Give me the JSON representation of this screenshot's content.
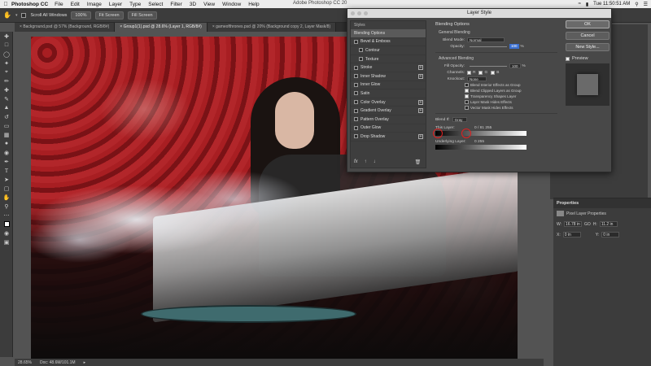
{
  "menubar": {
    "app": "Photoshop CC",
    "items": [
      "File",
      "Edit",
      "Image",
      "Layer",
      "Type",
      "Select",
      "Filter",
      "3D",
      "View",
      "Window",
      "Help"
    ],
    "center_title": "Adobe Photoshop CC 20",
    "clock": "Tue 11:50:51 AM"
  },
  "optbar": {
    "scroll_all": "Scroll All Windows",
    "zoom": "100%",
    "fit": "Fit Screen",
    "fill": "Fill Screen"
  },
  "tabs": [
    {
      "label": "Background.psd @ 57% (Background, RGB/8#)",
      "active": false
    },
    {
      "label": "Group1(1).psd @ 28.6% (Layer 1, RGB/8#)",
      "active": true
    },
    {
      "label": "gameofthrones.psd @ 20% (Background copy 2, Layer Mask/8)",
      "active": false
    }
  ],
  "status": {
    "zoom": "28.65%",
    "doc": "Doc: 48.6M/101.1M"
  },
  "dialog": {
    "title": "Layer Style",
    "styles_header": "Styles",
    "styles": [
      {
        "label": "Blending Options",
        "active": true,
        "checkbox": false,
        "plus": false
      },
      {
        "label": "Bevel & Emboss",
        "active": false,
        "checkbox": true,
        "plus": false
      },
      {
        "label": "Contour",
        "active": false,
        "checkbox": true,
        "plus": false,
        "indent": true
      },
      {
        "label": "Texture",
        "active": false,
        "checkbox": true,
        "plus": false,
        "indent": true
      },
      {
        "label": "Stroke",
        "active": false,
        "checkbox": true,
        "plus": true
      },
      {
        "label": "Inner Shadow",
        "active": false,
        "checkbox": true,
        "plus": true
      },
      {
        "label": "Inner Glow",
        "active": false,
        "checkbox": true,
        "plus": false
      },
      {
        "label": "Satin",
        "active": false,
        "checkbox": true,
        "plus": false
      },
      {
        "label": "Color Overlay",
        "active": false,
        "checkbox": true,
        "plus": true
      },
      {
        "label": "Gradient Overlay",
        "active": false,
        "checkbox": true,
        "plus": true
      },
      {
        "label": "Pattern Overlay",
        "active": false,
        "checkbox": true,
        "plus": false
      },
      {
        "label": "Outer Glow",
        "active": false,
        "checkbox": true,
        "plus": false
      },
      {
        "label": "Drop Shadow",
        "active": false,
        "checkbox": true,
        "plus": true
      }
    ],
    "blending": {
      "title": "Blending Options",
      "general": "General Blending",
      "blend_mode_label": "Blend Mode:",
      "blend_mode": "Normal",
      "opacity_label": "Opacity:",
      "opacity": "100",
      "percent": "%",
      "advanced": "Advanced Blending",
      "fill_opacity_label": "Fill Opacity:",
      "fill_opacity": "100",
      "channels_label": "Channels:",
      "channels": [
        "R",
        "G",
        "B"
      ],
      "knockout_label": "Knockout:",
      "knockout": "None",
      "options": [
        {
          "label": "Blend Interior Effects as Group",
          "checked": false
        },
        {
          "label": "Blend Clipped Layers as Group",
          "checked": true
        },
        {
          "label": "Transparency Shapes Layer",
          "checked": true
        },
        {
          "label": "Layer Mask Hides Effects",
          "checked": false
        },
        {
          "label": "Vector Mask Hides Effects",
          "checked": false
        }
      ],
      "blend_if_label": "Blend If:",
      "blend_if": "Gray",
      "this_layer_label": "This Layer:",
      "this_layer_values": "0 / 81    255",
      "underlying_label": "Underlying Layer:",
      "underlying_values": "0         255"
    },
    "buttons": {
      "ok": "OK",
      "cancel": "Cancel",
      "new_style": "New Style...",
      "preview": "Preview"
    },
    "footer": "fx"
  },
  "properties": {
    "title": "Properties",
    "subtitle": "Pixel Layer Properties",
    "w_label": "W:",
    "w": "16.78 in",
    "go": "GO",
    "h_label": "H:",
    "h": "11.2 in",
    "x_label": "X:",
    "x": "0 in",
    "y_label": "Y:",
    "y": "0 in"
  }
}
